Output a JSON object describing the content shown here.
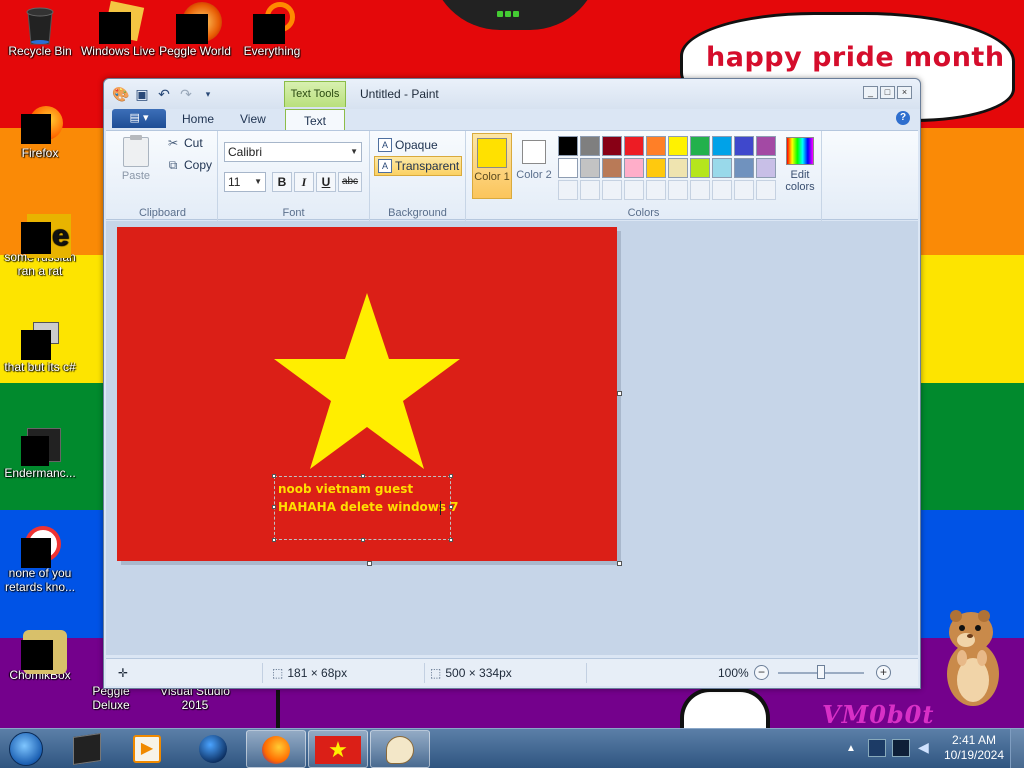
{
  "wallpaper": {
    "bubble_text": "happy pride month",
    "corner_text": "VM0b0t"
  },
  "desktop_icons": [
    {
      "label": "Recycle Bin"
    },
    {
      "label": "Windows Live"
    },
    {
      "label": "Peggle World"
    },
    {
      "label": "Everything"
    },
    {
      "label": "Firefox"
    },
    {
      "label": "some russian ran a rat"
    },
    {
      "label": "that but its c#"
    },
    {
      "label": "Endermanc..."
    },
    {
      "label": "none of you retards kno..."
    },
    {
      "label": "ChomikBox"
    },
    {
      "label": "Peggle Deluxe"
    },
    {
      "label": "Visual Studio 2015"
    }
  ],
  "paint": {
    "title": "Untitled - Paint",
    "context_tab": "Text Tools",
    "tabs": [
      "Home",
      "View",
      "Text"
    ],
    "active_tab": "Text",
    "clipboard": {
      "group": "Clipboard",
      "paste": "Paste",
      "cut": "Cut",
      "copy": "Copy"
    },
    "font": {
      "group": "Font",
      "family": "Calibri",
      "size": "11",
      "bold": "B",
      "italic": "I",
      "underline": "U",
      "strike": "abc"
    },
    "background": {
      "group": "Background",
      "opaque": "Opaque",
      "transparent": "Transparent",
      "selected": "Transparent"
    },
    "colors": {
      "group": "Colors",
      "color1_label": "Color 1",
      "color2_label": "Color 2",
      "color1": "#ffe100",
      "color2": "#ffffff",
      "edit_label": "Edit colors",
      "palette": [
        "#000000",
        "#7f7f7f",
        "#880015",
        "#ed1c24",
        "#ff7f27",
        "#fff200",
        "#22b14c",
        "#00a2e8",
        "#3f48cc",
        "#a349a4",
        "#ffffff",
        "#c3c3c3",
        "#b97a57",
        "#ffaec9",
        "#ffc90e",
        "#efe4b0",
        "#b5e61d",
        "#99d9ea",
        "#7092be",
        "#c8bfe7"
      ]
    },
    "canvas": {
      "text_lines": [
        "noob vietnam guest",
        "HAHAHA delete windows 7"
      ],
      "background_color": "#db1f17",
      "star_color": "#ffee00"
    },
    "status": {
      "selection_size": "181 × 68px",
      "image_size": "500 × 334px",
      "zoom": "100%",
      "zoom_level": 1.0
    }
  },
  "taskbar": {
    "time": "2:41 AM",
    "date": "10/19/2024",
    "pinned": [
      "terminal",
      "media-player",
      "globe",
      "firefox",
      "vietnam-flag-paint",
      "paint"
    ]
  }
}
